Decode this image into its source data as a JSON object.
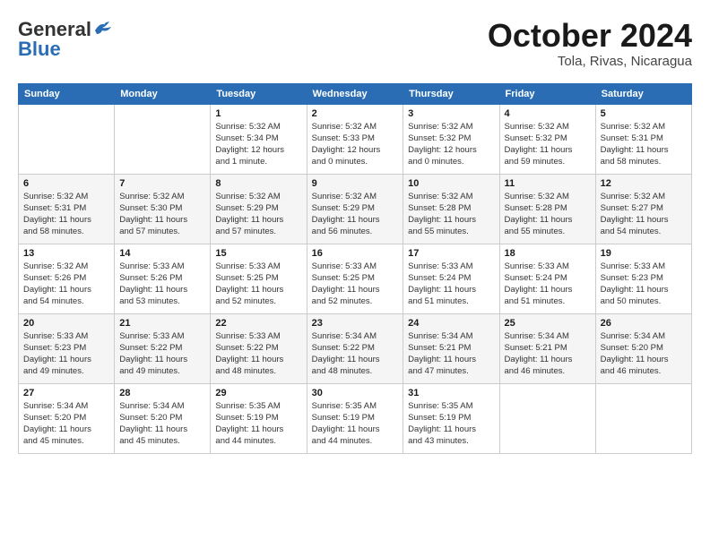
{
  "header": {
    "logo_line1": "General",
    "logo_line2": "Blue",
    "month": "October 2024",
    "location": "Tola, Rivas, Nicaragua"
  },
  "days_of_week": [
    "Sunday",
    "Monday",
    "Tuesday",
    "Wednesday",
    "Thursday",
    "Friday",
    "Saturday"
  ],
  "weeks": [
    [
      {
        "day": "",
        "content": ""
      },
      {
        "day": "",
        "content": ""
      },
      {
        "day": "1",
        "content": "Sunrise: 5:32 AM\nSunset: 5:34 PM\nDaylight: 12 hours\nand 1 minute."
      },
      {
        "day": "2",
        "content": "Sunrise: 5:32 AM\nSunset: 5:33 PM\nDaylight: 12 hours\nand 0 minutes."
      },
      {
        "day": "3",
        "content": "Sunrise: 5:32 AM\nSunset: 5:32 PM\nDaylight: 12 hours\nand 0 minutes."
      },
      {
        "day": "4",
        "content": "Sunrise: 5:32 AM\nSunset: 5:32 PM\nDaylight: 11 hours\nand 59 minutes."
      },
      {
        "day": "5",
        "content": "Sunrise: 5:32 AM\nSunset: 5:31 PM\nDaylight: 11 hours\nand 58 minutes."
      }
    ],
    [
      {
        "day": "6",
        "content": "Sunrise: 5:32 AM\nSunset: 5:31 PM\nDaylight: 11 hours\nand 58 minutes."
      },
      {
        "day": "7",
        "content": "Sunrise: 5:32 AM\nSunset: 5:30 PM\nDaylight: 11 hours\nand 57 minutes."
      },
      {
        "day": "8",
        "content": "Sunrise: 5:32 AM\nSunset: 5:29 PM\nDaylight: 11 hours\nand 57 minutes."
      },
      {
        "day": "9",
        "content": "Sunrise: 5:32 AM\nSunset: 5:29 PM\nDaylight: 11 hours\nand 56 minutes."
      },
      {
        "day": "10",
        "content": "Sunrise: 5:32 AM\nSunset: 5:28 PM\nDaylight: 11 hours\nand 55 minutes."
      },
      {
        "day": "11",
        "content": "Sunrise: 5:32 AM\nSunset: 5:28 PM\nDaylight: 11 hours\nand 55 minutes."
      },
      {
        "day": "12",
        "content": "Sunrise: 5:32 AM\nSunset: 5:27 PM\nDaylight: 11 hours\nand 54 minutes."
      }
    ],
    [
      {
        "day": "13",
        "content": "Sunrise: 5:32 AM\nSunset: 5:26 PM\nDaylight: 11 hours\nand 54 minutes."
      },
      {
        "day": "14",
        "content": "Sunrise: 5:33 AM\nSunset: 5:26 PM\nDaylight: 11 hours\nand 53 minutes."
      },
      {
        "day": "15",
        "content": "Sunrise: 5:33 AM\nSunset: 5:25 PM\nDaylight: 11 hours\nand 52 minutes."
      },
      {
        "day": "16",
        "content": "Sunrise: 5:33 AM\nSunset: 5:25 PM\nDaylight: 11 hours\nand 52 minutes."
      },
      {
        "day": "17",
        "content": "Sunrise: 5:33 AM\nSunset: 5:24 PM\nDaylight: 11 hours\nand 51 minutes."
      },
      {
        "day": "18",
        "content": "Sunrise: 5:33 AM\nSunset: 5:24 PM\nDaylight: 11 hours\nand 51 minutes."
      },
      {
        "day": "19",
        "content": "Sunrise: 5:33 AM\nSunset: 5:23 PM\nDaylight: 11 hours\nand 50 minutes."
      }
    ],
    [
      {
        "day": "20",
        "content": "Sunrise: 5:33 AM\nSunset: 5:23 PM\nDaylight: 11 hours\nand 49 minutes."
      },
      {
        "day": "21",
        "content": "Sunrise: 5:33 AM\nSunset: 5:22 PM\nDaylight: 11 hours\nand 49 minutes."
      },
      {
        "day": "22",
        "content": "Sunrise: 5:33 AM\nSunset: 5:22 PM\nDaylight: 11 hours\nand 48 minutes."
      },
      {
        "day": "23",
        "content": "Sunrise: 5:34 AM\nSunset: 5:22 PM\nDaylight: 11 hours\nand 48 minutes."
      },
      {
        "day": "24",
        "content": "Sunrise: 5:34 AM\nSunset: 5:21 PM\nDaylight: 11 hours\nand 47 minutes."
      },
      {
        "day": "25",
        "content": "Sunrise: 5:34 AM\nSunset: 5:21 PM\nDaylight: 11 hours\nand 46 minutes."
      },
      {
        "day": "26",
        "content": "Sunrise: 5:34 AM\nSunset: 5:20 PM\nDaylight: 11 hours\nand 46 minutes."
      }
    ],
    [
      {
        "day": "27",
        "content": "Sunrise: 5:34 AM\nSunset: 5:20 PM\nDaylight: 11 hours\nand 45 minutes."
      },
      {
        "day": "28",
        "content": "Sunrise: 5:34 AM\nSunset: 5:20 PM\nDaylight: 11 hours\nand 45 minutes."
      },
      {
        "day": "29",
        "content": "Sunrise: 5:35 AM\nSunset: 5:19 PM\nDaylight: 11 hours\nand 44 minutes."
      },
      {
        "day": "30",
        "content": "Sunrise: 5:35 AM\nSunset: 5:19 PM\nDaylight: 11 hours\nand 44 minutes."
      },
      {
        "day": "31",
        "content": "Sunrise: 5:35 AM\nSunset: 5:19 PM\nDaylight: 11 hours\nand 43 minutes."
      },
      {
        "day": "",
        "content": ""
      },
      {
        "day": "",
        "content": ""
      }
    ]
  ]
}
